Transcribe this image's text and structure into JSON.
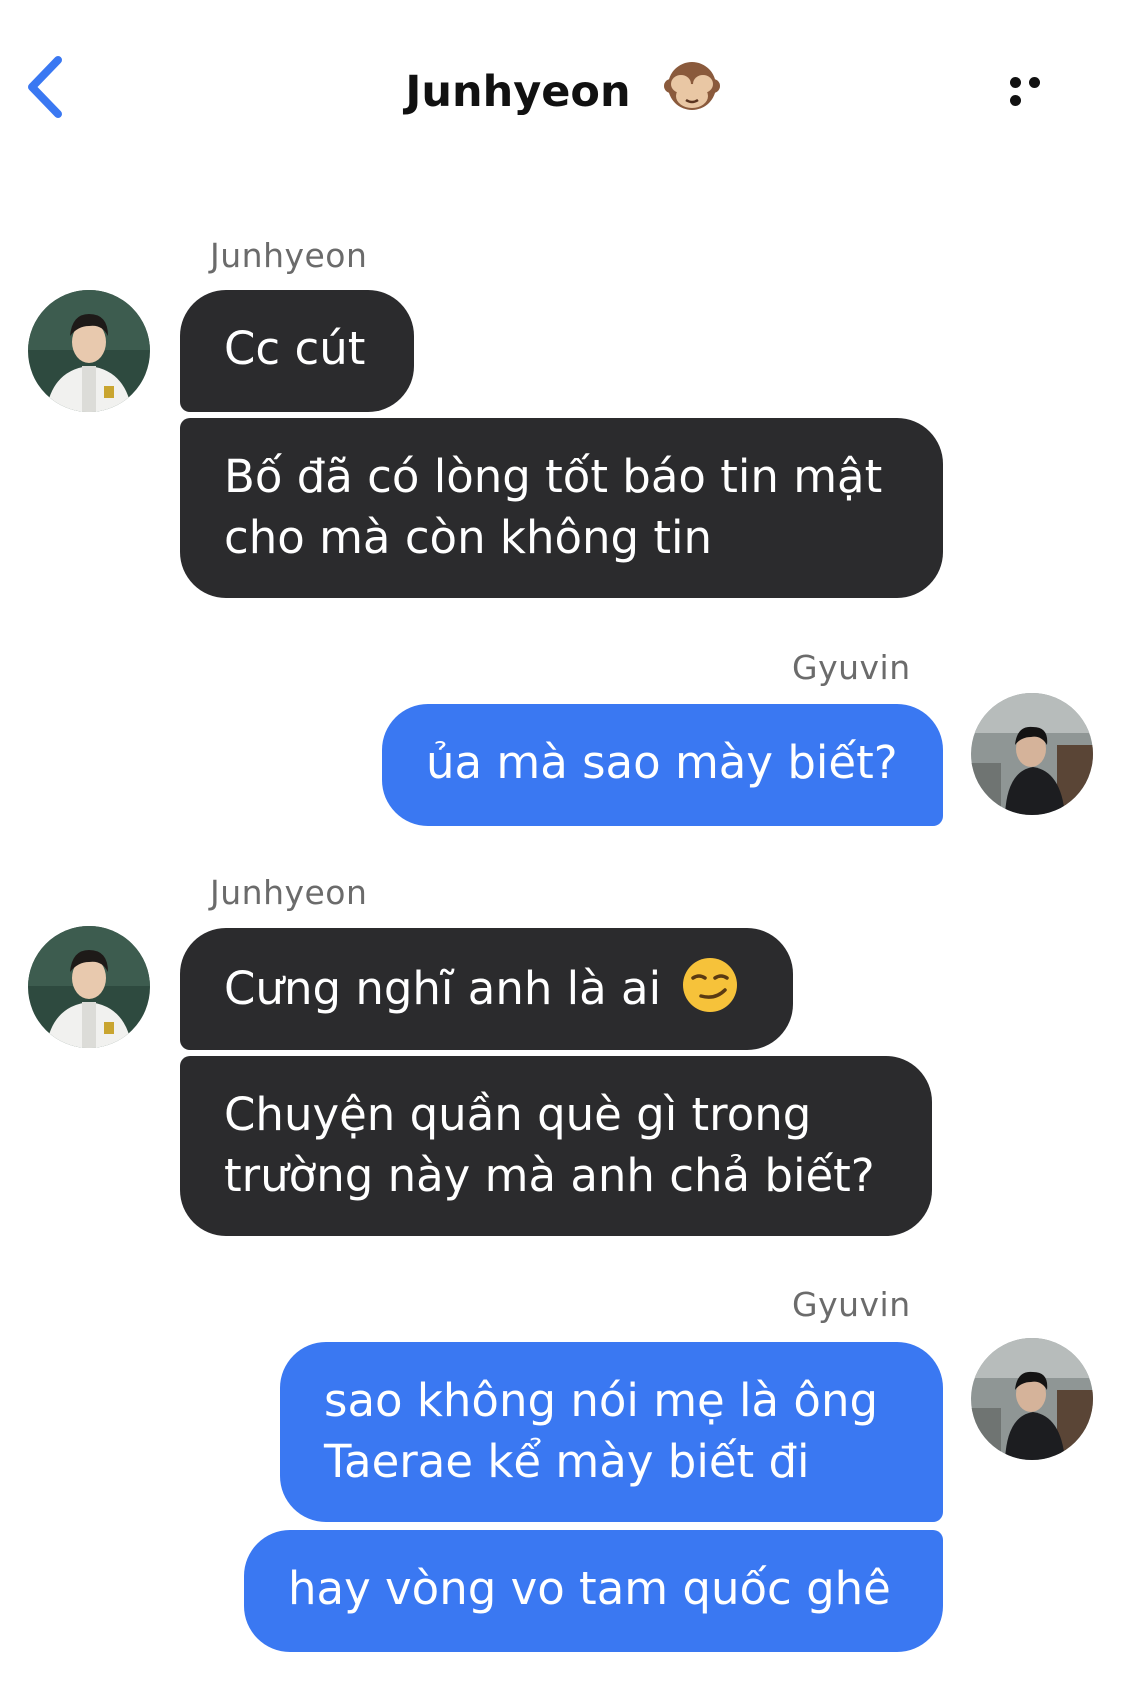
{
  "header": {
    "title": "Junhyeon",
    "title_emoji_icon": "see-no-evil-monkey-icon",
    "back_icon": "chevron-left-icon",
    "more_icon": "more-horizontal-icon"
  },
  "colors": {
    "accent": "#3a78f2",
    "incoming_bubble": "#2b2b2d",
    "outgoing_bubble": "#3a78f2",
    "sender_label": "#6b6b6b"
  },
  "messages": {
    "g1": {
      "sender": "Junhyeon",
      "m1": "Cc cút",
      "m2_line1": "Bố đã có lòng tốt báo tin mật",
      "m2_line2": "cho mà còn không tin"
    },
    "g2": {
      "sender": "Gyuvin",
      "m1": "ủa mà sao mày biết?"
    },
    "g3": {
      "sender": "Junhyeon",
      "m1": "Cưng nghĩ anh là ai",
      "m1_emoji_icon": "smirk-face-icon",
      "m2_line1": "Chuyện quần què gì trong",
      "m2_line2": "trường này mà anh chả biết?"
    },
    "g4": {
      "sender": "Gyuvin",
      "m1_line1": "sao không nói mẹ là ông",
      "m1_line2": "Taerae kể mày biết đi",
      "m2": "hay vòng vo tam quốc ghê"
    }
  }
}
